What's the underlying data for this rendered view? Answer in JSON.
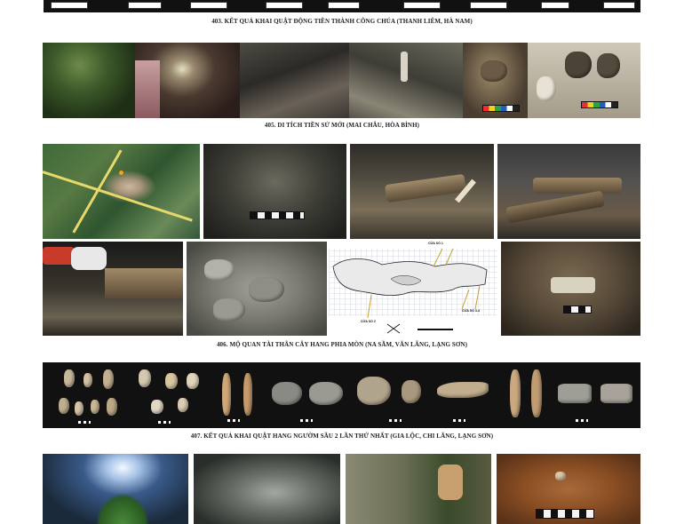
{
  "sections": {
    "s403": {
      "caption": "403. KẾT QUẢ KHAI QUẬT ĐỘNG TIỀN THÀNH CÔNG CHÚA (THANH LIÊM, HÀ NAM)"
    },
    "s405": {
      "caption": "405. DI TÍCH TIỀN SỬ MỚI (MAI CHÂU, HÒA BÌNH)"
    },
    "s406": {
      "caption": "406. MỘ QUAN TÀI THÂN CÂY HANG PHIA MÒN (NA SẦM, VĂN LÃNG, LẠNG SƠN)",
      "plan_labels": {
        "door1": "CỬA SỐ 1",
        "door2": "CỬA SỐ 2",
        "door34": "CỬA SỐ 3-4"
      }
    },
    "s407": {
      "caption": "407. KẾT QUẢ KHAI QUẬT HANG NGƯỜM SẦU 2 LẦN THỨ NHẤT (GIA LỘC, CHI LĂNG, LẠNG SƠN)"
    }
  },
  "colors": {
    "background": "#ffffff",
    "photo_frame": "#111111",
    "caption_text": "#222222"
  }
}
